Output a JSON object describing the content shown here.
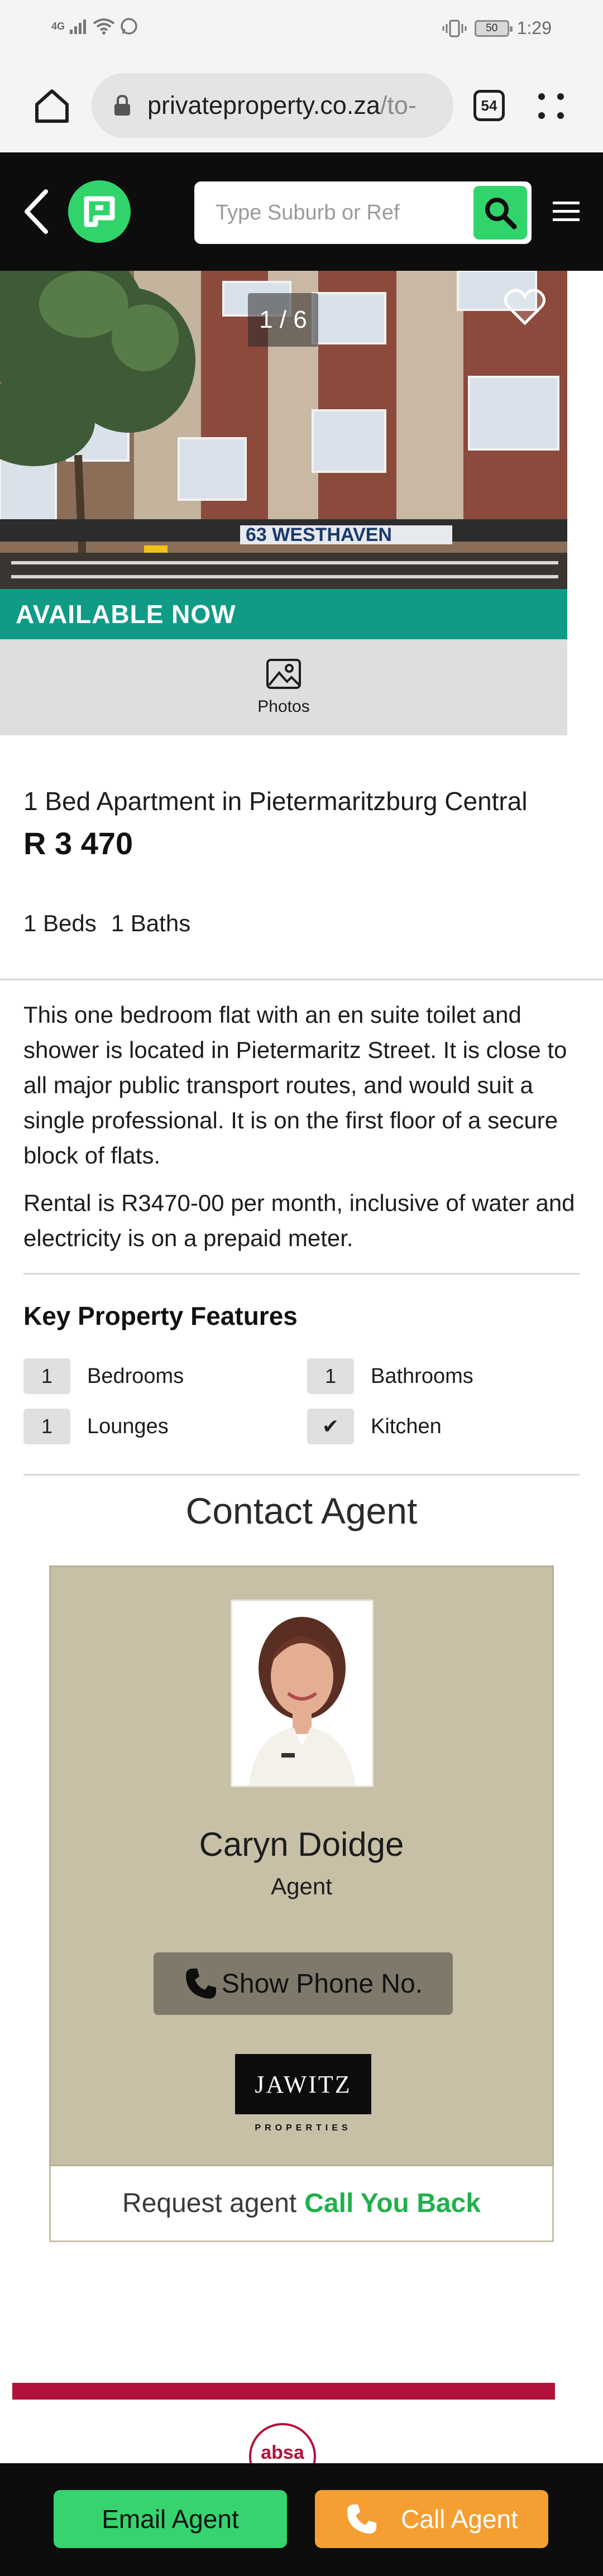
{
  "status_bar": {
    "network": "4G",
    "battery": "50",
    "time": "1:29"
  },
  "browser": {
    "url_main": "privateproperty.co.za",
    "url_rest": "/to-",
    "tab_count": "54"
  },
  "header": {
    "search_placeholder": "Type Suburb or Ref"
  },
  "gallery": {
    "counter": "1 / 6",
    "building_sign": "63  WESTHAVEN",
    "status_banner": "AVAILABLE NOW",
    "photos_label": "Photos"
  },
  "listing": {
    "title": "1 Bed Apartment in Pietermaritzburg Central",
    "price": "R 3 470",
    "beds": "1 Beds",
    "baths": "1 Baths",
    "description": [
      "This one bedroom flat with an en suite toilet and shower is located in Pietermaritz Street. It is close to all major public transport routes, and would suit a single professional. It is on the first floor of a secure block of flats.",
      "Rental is R3470-00 per month, inclusive of water and electricity is on a prepaid meter."
    ]
  },
  "features": {
    "title": "Key Property Features",
    "items": [
      {
        "value": "1",
        "label": "Bedrooms"
      },
      {
        "value": "1",
        "label": "Bathrooms"
      },
      {
        "value": "1",
        "label": "Lounges"
      },
      {
        "value": "✔",
        "label": "Kitchen"
      }
    ]
  },
  "contact": {
    "title": "Contact Agent",
    "agent_name": "Caryn Doidge",
    "agent_role": "Agent",
    "phone_button": "Show Phone No.",
    "agency_name": "JAWITZ",
    "agency_sub": "PROPERTIES",
    "callback_prefix": "Request agent",
    "callback_action": "Call You Back"
  },
  "ad": {
    "brand": "absa"
  },
  "bottom_bar": {
    "email_label": "Email Agent",
    "call_label": "Call Agent"
  },
  "colors": {
    "brand_green": "#30d46b",
    "available_teal": "#0f9b86",
    "call_orange": "#f59e31",
    "agent_card_bg": "#c7c0a7",
    "ad_red": "#b0123a"
  }
}
